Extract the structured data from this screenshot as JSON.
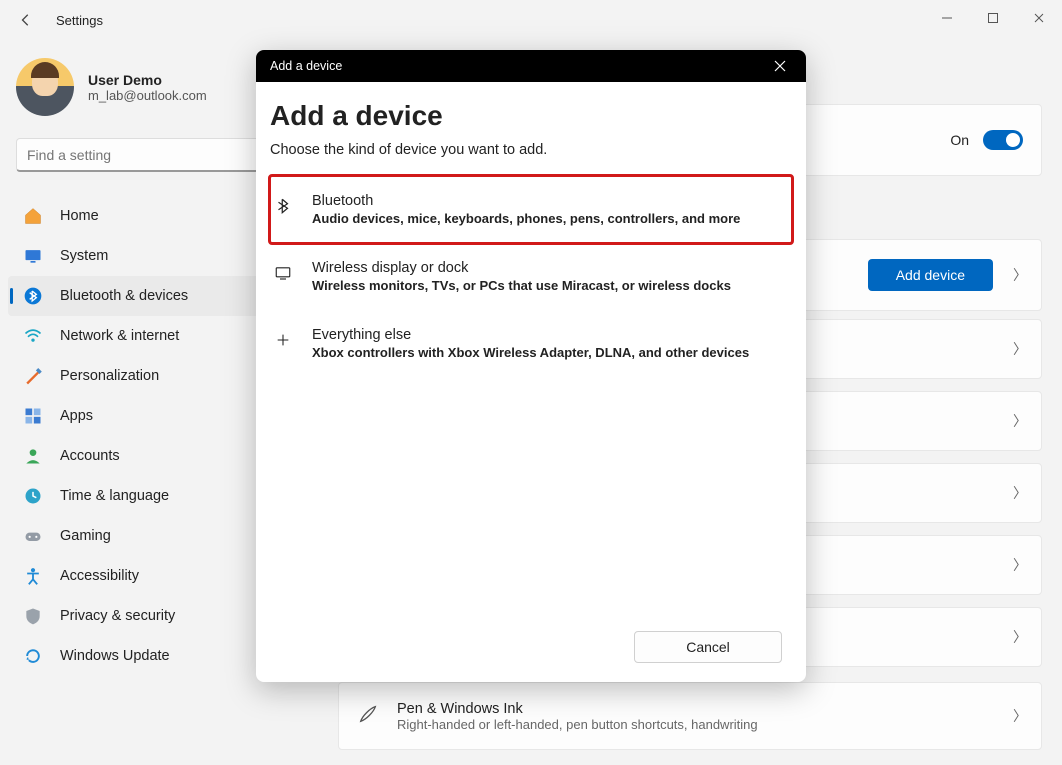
{
  "window": {
    "title": "Settings"
  },
  "user": {
    "name": "User Demo",
    "email": "m_lab@outlook.com"
  },
  "search": {
    "placeholder": "Find a setting"
  },
  "sidebar": {
    "items": [
      {
        "label": "Home"
      },
      {
        "label": "System"
      },
      {
        "label": "Bluetooth & devices"
      },
      {
        "label": "Network & internet"
      },
      {
        "label": "Personalization"
      },
      {
        "label": "Apps"
      },
      {
        "label": "Accounts"
      },
      {
        "label": "Time & language"
      },
      {
        "label": "Gaming"
      },
      {
        "label": "Accessibility"
      },
      {
        "label": "Privacy & security"
      },
      {
        "label": "Windows Update"
      }
    ]
  },
  "bluetooth_toggle": {
    "state_label": "On"
  },
  "add_device_button": "Add device",
  "pen_row": {
    "title": "Pen & Windows Ink",
    "subtitle": "Right-handed or left-handed, pen button shortcuts, handwriting"
  },
  "dialog": {
    "titlebar": "Add a device",
    "heading": "Add a device",
    "prompt": "Choose the kind of device you want to add.",
    "options": [
      {
        "title": "Bluetooth",
        "desc": "Audio devices, mice, keyboards, phones, pens, controllers, and more"
      },
      {
        "title": "Wireless display or dock",
        "desc": "Wireless monitors, TVs, or PCs that use Miracast, or wireless docks"
      },
      {
        "title": "Everything else",
        "desc": "Xbox controllers with Xbox Wireless Adapter, DLNA, and other devices"
      }
    ],
    "cancel": "Cancel"
  }
}
